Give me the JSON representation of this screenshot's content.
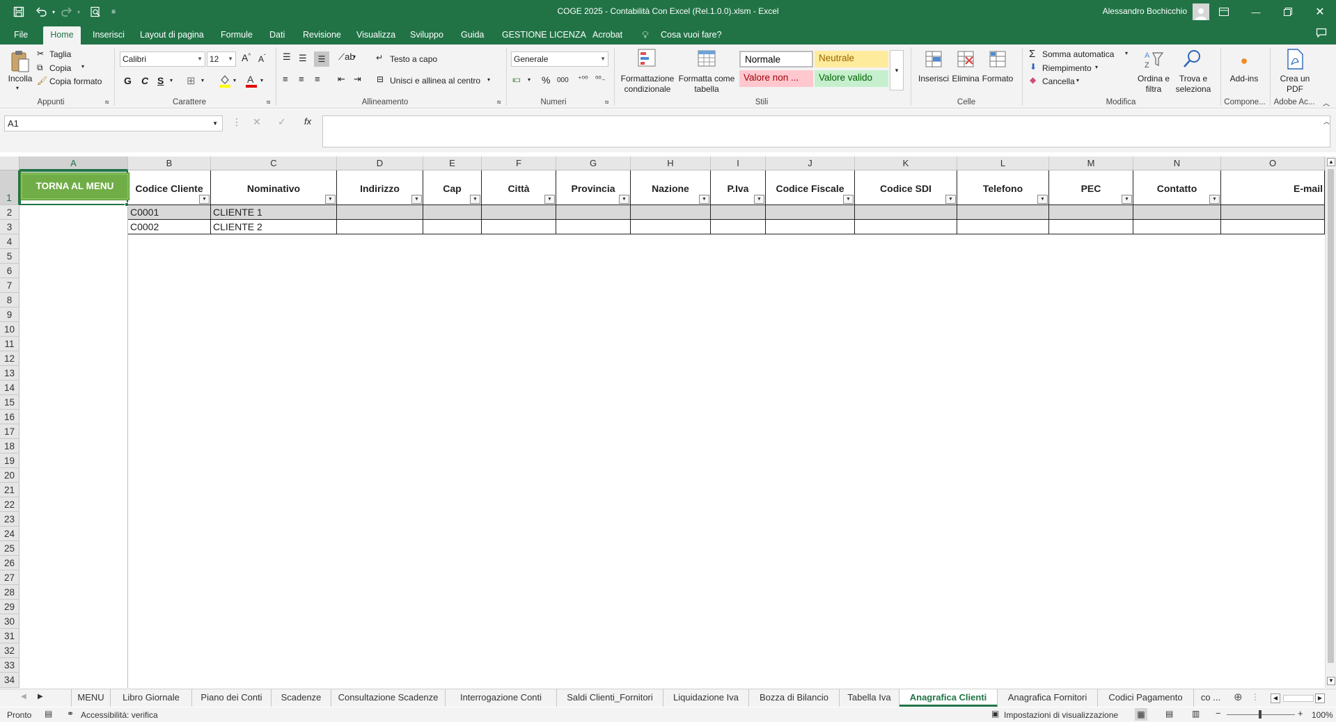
{
  "window": {
    "title": "COGE 2025 - Contabilità Con Excel (Rel.1.0.0).xlsm  -  Excel",
    "user": "Alessandro Bochicchio"
  },
  "menu_tabs": [
    "File",
    "Home",
    "Inserisci",
    "Layout di pagina",
    "Formule",
    "Dati",
    "Revisione",
    "Visualizza",
    "Sviluppo",
    "Guida",
    "GESTIONE LICENZA",
    "Acrobat",
    "Cosa vuoi fare?"
  ],
  "ribbon": {
    "clipboard": {
      "paste": "Incolla",
      "cut": "Taglia",
      "copy": "Copia",
      "format_painter": "Copia formato",
      "label": "Appunti"
    },
    "font": {
      "name": "Calibri",
      "size": "12",
      "bold": "G",
      "italic": "C",
      "underline": "S",
      "label": "Carattere"
    },
    "alignment": {
      "wrap": "Testo a capo",
      "merge": "Unisci e allinea al centro",
      "label": "Allineamento"
    },
    "number": {
      "format": "Generale",
      "label": "Numeri",
      "percent": "%",
      "thousands": "000"
    },
    "styles": {
      "conditional": "Formattazione condizionale",
      "as_table": "Formatta come tabella",
      "normal": "Normale",
      "neutral": "Neutrale",
      "bad": "Valore non ...",
      "good": "Valore valido",
      "label": "Stili",
      "colors": {
        "neutral_bg": "#ffeb9c",
        "neutral_fg": "#9c6500",
        "bad_bg": "#ffc7ce",
        "bad_fg": "#9c0006",
        "good_bg": "#c6efce",
        "good_fg": "#006100"
      }
    },
    "cells": {
      "insert": "Inserisci",
      "delete": "Elimina",
      "format": "Formato",
      "label": "Celle"
    },
    "editing": {
      "autosum": "Somma automatica",
      "fill": "Riempimento",
      "clear": "Cancella",
      "sort": "Ordina e filtra",
      "find": "Trova e seleziona",
      "label": "Modifica"
    },
    "addins": {
      "button": "Add-ins",
      "label": "Compone..."
    },
    "adobe": {
      "button": "Crea un PDF",
      "label": "Adobe Ac..."
    }
  },
  "formula_bar": {
    "name_box": "A1",
    "formula": ""
  },
  "columns": [
    "A",
    "B",
    "C",
    "D",
    "E",
    "F",
    "G",
    "H",
    "I",
    "J",
    "K",
    "L",
    "M",
    "N",
    "O"
  ],
  "rows": [
    "1",
    "2",
    "3",
    "4",
    "5",
    "6",
    "7",
    "8",
    "9",
    "10",
    "11",
    "12",
    "13",
    "14",
    "15",
    "16",
    "17",
    "18",
    "19",
    "20",
    "21",
    "22",
    "23",
    "24",
    "25",
    "26",
    "27",
    "28",
    "29",
    "30",
    "31",
    "32",
    "33",
    "34"
  ],
  "menu_button": "TORNA AL MENU",
  "table": {
    "headers": [
      "Codice Cliente",
      "Nominativo",
      "Indirizzo",
      "Cap",
      "Città",
      "Provincia",
      "Nazione",
      "P.Iva",
      "Codice Fiscale",
      "Codice SDI",
      "Telefono",
      "PEC",
      "Contatto",
      "E-mail"
    ],
    "rows": [
      [
        "C0001",
        "CLIENTE 1",
        "",
        "",
        "",
        "",
        "",
        "",
        "",
        "",
        "",
        "",
        "",
        ""
      ],
      [
        "C0002",
        "CLIENTE 2",
        "",
        "",
        "",
        "",
        "",
        "",
        "",
        "",
        "",
        "",
        "",
        ""
      ]
    ]
  },
  "sheets": [
    "MENU",
    "Libro Giornale",
    "Piano dei Conti",
    "Scadenze",
    "Consultazione Scadenze",
    "Interrogazione Conti",
    "Saldi Clienti_Fornitori",
    "Liquidazione Iva",
    "Bozza di Bilancio",
    "Tabella Iva",
    "Anagrafica Clienti",
    "Anagrafica Fornitori",
    "Codici Pagamento",
    "co ..."
  ],
  "active_sheet": "Anagrafica Clienti",
  "status": {
    "ready": "Pronto",
    "accessibility": "Accessibilità: verifica",
    "display_settings": "Impostazioni di visualizzazione",
    "zoom": "100%"
  }
}
